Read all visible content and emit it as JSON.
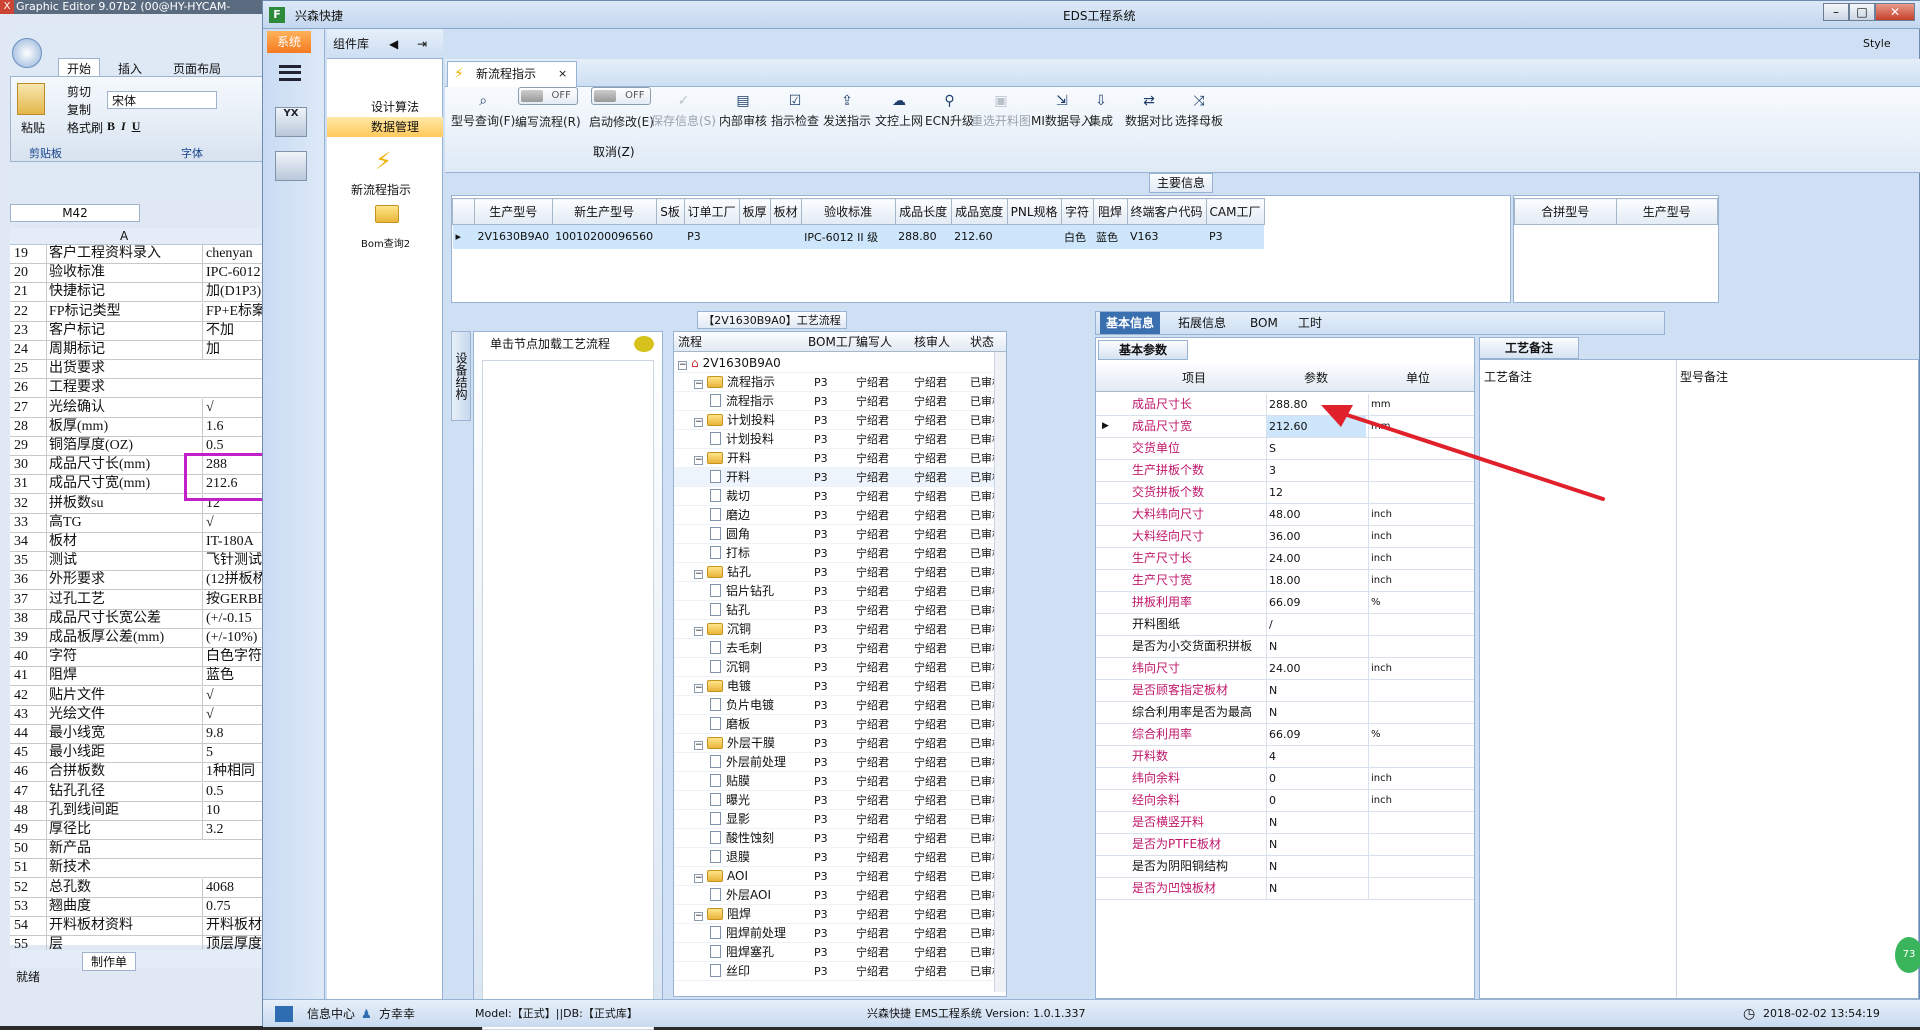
{
  "excel": {
    "title": "Graphic Editor 9.07b2 (00@HY-HYCAM-",
    "tabs": [
      "开始",
      "插入",
      "页面布局"
    ],
    "clipboard": [
      "剪切",
      "复制",
      "格式刷"
    ],
    "paste_label": "粘贴",
    "group_clipboard": "剪贴板",
    "group_font": "字体",
    "font_name": "宋体",
    "cell_ref": "M42",
    "col_a": "A",
    "sheet_tab": "制作单",
    "status": "就绪",
    "rows": [
      {
        "n": "19",
        "a": "客户工程资料录入",
        "b": "chenyan"
      },
      {
        "n": "20",
        "a": "验收标准",
        "b": "IPC-6012"
      },
      {
        "n": "21",
        "a": "快捷标记",
        "b": "加(D1P3)"
      },
      {
        "n": "22",
        "a": "FP标记类型",
        "b": "FP+E标案"
      },
      {
        "n": "23",
        "a": "客户标记",
        "b": "不加"
      },
      {
        "n": "24",
        "a": "周期标记",
        "b": "加"
      },
      {
        "n": "25",
        "a": "出货要求",
        "b": ""
      },
      {
        "n": "26",
        "a": "工程要求",
        "b": ""
      },
      {
        "n": "27",
        "a": "光绘确认",
        "b": "√"
      },
      {
        "n": "28",
        "a": "板厚(mm)",
        "b": "1.6"
      },
      {
        "n": "29",
        "a": "铜箔厚度(OZ)",
        "b": "0.5"
      },
      {
        "n": "30",
        "a": "成品尺寸长(mm)",
        "b": "288"
      },
      {
        "n": "31",
        "a": "成品尺寸宽(mm)",
        "b": "212.6"
      },
      {
        "n": "32",
        "a": "拼板数su",
        "b": "12"
      },
      {
        "n": "33",
        "a": "高TG",
        "b": "√"
      },
      {
        "n": "34",
        "a": "板材",
        "b": "IT-180A"
      },
      {
        "n": "35",
        "a": "测试",
        "b": "飞针测试"
      },
      {
        "n": "36",
        "a": "外形要求",
        "b": "(12拼板桥"
      },
      {
        "n": "37",
        "a": "过孔工艺",
        "b": "按GERBER"
      },
      {
        "n": "38",
        "a": "成品尺寸长宽公差",
        "b": "(+/-0.15"
      },
      {
        "n": "39",
        "a": "成品板厚公差(mm)",
        "b": "(+/-10%)"
      },
      {
        "n": "40",
        "a": "字符",
        "b": "白色字符"
      },
      {
        "n": "41",
        "a": "阻焊",
        "b": "蓝色"
      },
      {
        "n": "42",
        "a": "贴片文件",
        "b": "√"
      },
      {
        "n": "43",
        "a": "光绘文件",
        "b": "√"
      },
      {
        "n": "44",
        "a": "最小线宽",
        "b": "9.8"
      },
      {
        "n": "45",
        "a": "最小线距",
        "b": "5"
      },
      {
        "n": "46",
        "a": "合拼板数",
        "b": "1种相同"
      },
      {
        "n": "47",
        "a": "钻孔孔径",
        "b": "0.5"
      },
      {
        "n": "48",
        "a": "孔到线间距",
        "b": "10"
      },
      {
        "n": "49",
        "a": "厚径比",
        "b": "3.2"
      },
      {
        "n": "50",
        "a": "新产品",
        "b": ""
      },
      {
        "n": "51",
        "a": "新技术",
        "b": ""
      },
      {
        "n": "52",
        "a": "总孔数",
        "b": "4068"
      },
      {
        "n": "53",
        "a": "翘曲度",
        "b": "0.75"
      },
      {
        "n": "54",
        "a": "开料板材资料",
        "b": "开料板材"
      },
      {
        "n": "55",
        "a": "层",
        "b": "顶层厚度"
      }
    ]
  },
  "app": {
    "title": "EDS工程系统",
    "brand": "兴森快捷",
    "system_menu": "系统",
    "component_lib": "组件库",
    "comp_items": [
      "设计算法",
      "数据管理"
    ],
    "shortcuts": [
      "新流程指示",
      "Bom查询2"
    ],
    "style_label": "Style",
    "doc_tab": "新流程指示",
    "toolbar": [
      {
        "label": "型号查询(F)",
        "icon": "search-icon",
        "disabled": false
      },
      {
        "label": "编写流程(R)",
        "icon": "toggle-off",
        "disabled": false
      },
      {
        "label": "启动修改(E)",
        "icon": "toggle-off",
        "disabled": false
      },
      {
        "label": "保存信息(S)",
        "icon": "check-icon",
        "disabled": true
      },
      {
        "label": "内部审核",
        "icon": "print-icon",
        "disabled": false
      },
      {
        "label": "指示检查",
        "icon": "checklist-icon",
        "disabled": false
      },
      {
        "label": "发送指示",
        "icon": "upload-icon",
        "disabled": false
      },
      {
        "label": "文控上网",
        "icon": "cloud-upload-icon",
        "disabled": false
      },
      {
        "label": "ECN升级",
        "icon": "binoculars-icon",
        "disabled": false
      },
      {
        "label": "重选开料图",
        "icon": "image-icon",
        "disabled": true
      },
      {
        "label": "MI数据导入",
        "icon": "import-icon",
        "disabled": false
      },
      {
        "label": "集成",
        "icon": "download-icon",
        "disabled": false
      },
      {
        "label": "数据对比",
        "icon": "compare-icon",
        "disabled": false
      },
      {
        "label": "选择母板",
        "icon": "shuffle-icon",
        "disabled": false
      }
    ],
    "toggle_off": "OFF",
    "cancel_label": "取消(Z)",
    "main_info_title": "主要信息",
    "main_headers": [
      "生产型号",
      "新生产型号",
      "S板",
      "订单工厂",
      "板厚",
      "板材",
      "验收标准",
      "成品长度",
      "成品宽度",
      "PNL规格",
      "字符",
      "阻焊",
      "终端客户代码",
      "CAM工厂"
    ],
    "main_row": [
      "2V1630B9A0",
      "10010200096560",
      "",
      "P3",
      "",
      "",
      "IPC-6012 II 级",
      "288.80",
      "212.60",
      "",
      "白色",
      "蓝色",
      "V163",
      "P3"
    ],
    "merge_headers": [
      "合拼型号",
      "生产型号"
    ],
    "flow_title": "【2V1630B9A0】工艺流程",
    "side_tab": "设备结构",
    "load_hint": "单击节点加载工艺流程",
    "tree_headers": [
      "流程",
      "BOM工厂",
      "编写人",
      "核审人",
      "状态"
    ],
    "tree": [
      {
        "l": 0,
        "t": "root",
        "name": "2V1630B9A0",
        "f": "",
        "w": "",
        "r": "",
        "s": ""
      },
      {
        "l": 1,
        "t": "fold",
        "name": "流程指示",
        "f": "P3",
        "w": "宁绍君",
        "r": "宁绍君",
        "s": "已审核"
      },
      {
        "l": 2,
        "t": "doc",
        "name": "流程指示",
        "f": "P3",
        "w": "宁绍君",
        "r": "宁绍君",
        "s": "已审核"
      },
      {
        "l": 1,
        "t": "fold",
        "name": "计划投料",
        "f": "P3",
        "w": "宁绍君",
        "r": "宁绍君",
        "s": "已审核"
      },
      {
        "l": 2,
        "t": "doc",
        "name": "计划投料",
        "f": "P3",
        "w": "宁绍君",
        "r": "宁绍君",
        "s": "已审核"
      },
      {
        "l": 1,
        "t": "fold",
        "name": "开料",
        "f": "P3",
        "w": "宁绍君",
        "r": "宁绍君",
        "s": "已审核"
      },
      {
        "l": 2,
        "t": "doc",
        "name": "开料",
        "f": "P3",
        "w": "宁绍君",
        "r": "宁绍君",
        "s": "已审核"
      },
      {
        "l": 2,
        "t": "doc",
        "name": "裁切",
        "f": "P3",
        "w": "宁绍君",
        "r": "宁绍君",
        "s": "已审核"
      },
      {
        "l": 2,
        "t": "doc",
        "name": "磨边",
        "f": "P3",
        "w": "宁绍君",
        "r": "宁绍君",
        "s": "已审核"
      },
      {
        "l": 2,
        "t": "doc",
        "name": "圆角",
        "f": "P3",
        "w": "宁绍君",
        "r": "宁绍君",
        "s": "已审核"
      },
      {
        "l": 2,
        "t": "doc",
        "name": "打标",
        "f": "P3",
        "w": "宁绍君",
        "r": "宁绍君",
        "s": "已审核"
      },
      {
        "l": 1,
        "t": "fold",
        "name": "钻孔",
        "f": "P3",
        "w": "宁绍君",
        "r": "宁绍君",
        "s": "已审核"
      },
      {
        "l": 2,
        "t": "doc",
        "name": "铝片钻孔",
        "f": "P3",
        "w": "宁绍君",
        "r": "宁绍君",
        "s": "已审核"
      },
      {
        "l": 2,
        "t": "doc",
        "name": "钻孔",
        "f": "P3",
        "w": "宁绍君",
        "r": "宁绍君",
        "s": "已审核"
      },
      {
        "l": 1,
        "t": "fold",
        "name": "沉铜",
        "f": "P3",
        "w": "宁绍君",
        "r": "宁绍君",
        "s": "已审核"
      },
      {
        "l": 2,
        "t": "doc",
        "name": "去毛刺",
        "f": "P3",
        "w": "宁绍君",
        "r": "宁绍君",
        "s": "已审核"
      },
      {
        "l": 2,
        "t": "doc",
        "name": "沉铜",
        "f": "P3",
        "w": "宁绍君",
        "r": "宁绍君",
        "s": "已审核"
      },
      {
        "l": 1,
        "t": "fold",
        "name": "电镀",
        "f": "P3",
        "w": "宁绍君",
        "r": "宁绍君",
        "s": "已审核"
      },
      {
        "l": 2,
        "t": "doc",
        "name": "负片电镀",
        "f": "P3",
        "w": "宁绍君",
        "r": "宁绍君",
        "s": "已审核"
      },
      {
        "l": 2,
        "t": "doc",
        "name": "磨板",
        "f": "P3",
        "w": "宁绍君",
        "r": "宁绍君",
        "s": "已审核"
      },
      {
        "l": 1,
        "t": "fold",
        "name": "外层干膜",
        "f": "P3",
        "w": "宁绍君",
        "r": "宁绍君",
        "s": "已审核"
      },
      {
        "l": 2,
        "t": "doc",
        "name": "外层前处理",
        "f": "P3",
        "w": "宁绍君",
        "r": "宁绍君",
        "s": "已审核"
      },
      {
        "l": 2,
        "t": "doc",
        "name": "贴膜",
        "f": "P3",
        "w": "宁绍君",
        "r": "宁绍君",
        "s": "已审核"
      },
      {
        "l": 2,
        "t": "doc",
        "name": "曝光",
        "f": "P3",
        "w": "宁绍君",
        "r": "宁绍君",
        "s": "已审核"
      },
      {
        "l": 2,
        "t": "doc",
        "name": "显影",
        "f": "P3",
        "w": "宁绍君",
        "r": "宁绍君",
        "s": "已审核"
      },
      {
        "l": 2,
        "t": "doc",
        "name": "酸性蚀刻",
        "f": "P3",
        "w": "宁绍君",
        "r": "宁绍君",
        "s": "已审核"
      },
      {
        "l": 2,
        "t": "doc",
        "name": "退膜",
        "f": "P3",
        "w": "宁绍君",
        "r": "宁绍君",
        "s": "已审核"
      },
      {
        "l": 1,
        "t": "fold",
        "name": "AOI",
        "f": "P3",
        "w": "宁绍君",
        "r": "宁绍君",
        "s": "已审核"
      },
      {
        "l": 2,
        "t": "doc",
        "name": "外层AOI",
        "f": "P3",
        "w": "宁绍君",
        "r": "宁绍君",
        "s": "已审核"
      },
      {
        "l": 1,
        "t": "fold",
        "name": "阻焊",
        "f": "P3",
        "w": "宁绍君",
        "r": "宁绍君",
        "s": "已审核"
      },
      {
        "l": 2,
        "t": "doc",
        "name": "阻焊前处理",
        "f": "P3",
        "w": "宁绍君",
        "r": "宁绍君",
        "s": "已审核"
      },
      {
        "l": 2,
        "t": "doc",
        "name": "阻焊塞孔",
        "f": "P3",
        "w": "宁绍君",
        "r": "宁绍君",
        "s": "已审核"
      },
      {
        "l": 2,
        "t": "doc",
        "name": "丝印",
        "f": "P3",
        "w": "宁绍君",
        "r": "宁绍君",
        "s": "已审核"
      }
    ],
    "detail_tabs": [
      "基本信息",
      "拓展信息",
      "BOM",
      "工时"
    ],
    "basic_params": "基本参数",
    "param_headers": [
      "项目",
      "参数",
      "单位"
    ],
    "params": [
      {
        "k": "成品尺寸长",
        "v": "288.80",
        "u": "mm",
        "pink": true
      },
      {
        "k": "成品尺寸宽",
        "v": "212.60",
        "u": "mm",
        "pink": true
      },
      {
        "k": "交货单位",
        "v": "S",
        "u": "",
        "pink": true
      },
      {
        "k": "生产拼板个数",
        "v": "3",
        "u": "",
        "pink": true
      },
      {
        "k": "交货拼板个数",
        "v": "12",
        "u": "",
        "pink": true
      },
      {
        "k": "大料纬向尺寸",
        "v": "48.00",
        "u": "inch",
        "pink": true
      },
      {
        "k": "大料经向尺寸",
        "v": "36.00",
        "u": "inch",
        "pink": true
      },
      {
        "k": "生产尺寸长",
        "v": "24.00",
        "u": "inch",
        "pink": true
      },
      {
        "k": "生产尺寸宽",
        "v": "18.00",
        "u": "inch",
        "pink": true
      },
      {
        "k": "拼板利用率",
        "v": "66.09",
        "u": "%",
        "pink": true
      },
      {
        "k": "开料图纸",
        "v": "/",
        "u": "",
        "pink": false
      },
      {
        "k": "是否为小交货面积拼板",
        "v": "N",
        "u": "",
        "pink": false
      },
      {
        "k": "纬向尺寸",
        "v": "24.00",
        "u": "inch",
        "pink": true
      },
      {
        "k": "是否顾客指定板材",
        "v": "N",
        "u": "",
        "pink": true
      },
      {
        "k": "综合利用率是否为最高",
        "v": "N",
        "u": "",
        "pink": false
      },
      {
        "k": "综合利用率",
        "v": "66.09",
        "u": "%",
        "pink": true
      },
      {
        "k": "开料数",
        "v": "4",
        "u": "",
        "pink": true
      },
      {
        "k": "纬向余料",
        "v": "0",
        "u": "inch",
        "pink": true
      },
      {
        "k": "经向余料",
        "v": "0",
        "u": "inch",
        "pink": true
      },
      {
        "k": "是否横竖开料",
        "v": "N",
        "u": "",
        "pink": true
      },
      {
        "k": "是否为PTFE板材",
        "v": "N",
        "u": "",
        "pink": true
      },
      {
        "k": "是否为阴阳铜结构",
        "v": "N",
        "u": "",
        "pink": false
      },
      {
        "k": "是否为凹蚀板材",
        "v": "N",
        "u": "",
        "pink": true
      }
    ],
    "process_note_tab": "工艺备注",
    "process_note_col": "工艺备注",
    "model_note_col": "型号备注",
    "status": {
      "info_center": "信息中心",
      "user": "方幸幸",
      "model": "Model:【正式】||DB:【正式库】",
      "version": "兴森快捷  EMS工程系统  Version: 1.0.1.337",
      "datetime": "2018-02-02  13:54:19"
    },
    "colors": {
      "accent": "#f47a20",
      "pink": "#c0186b",
      "highlight": "#c321c8",
      "arrow": "#e0202a"
    }
  }
}
